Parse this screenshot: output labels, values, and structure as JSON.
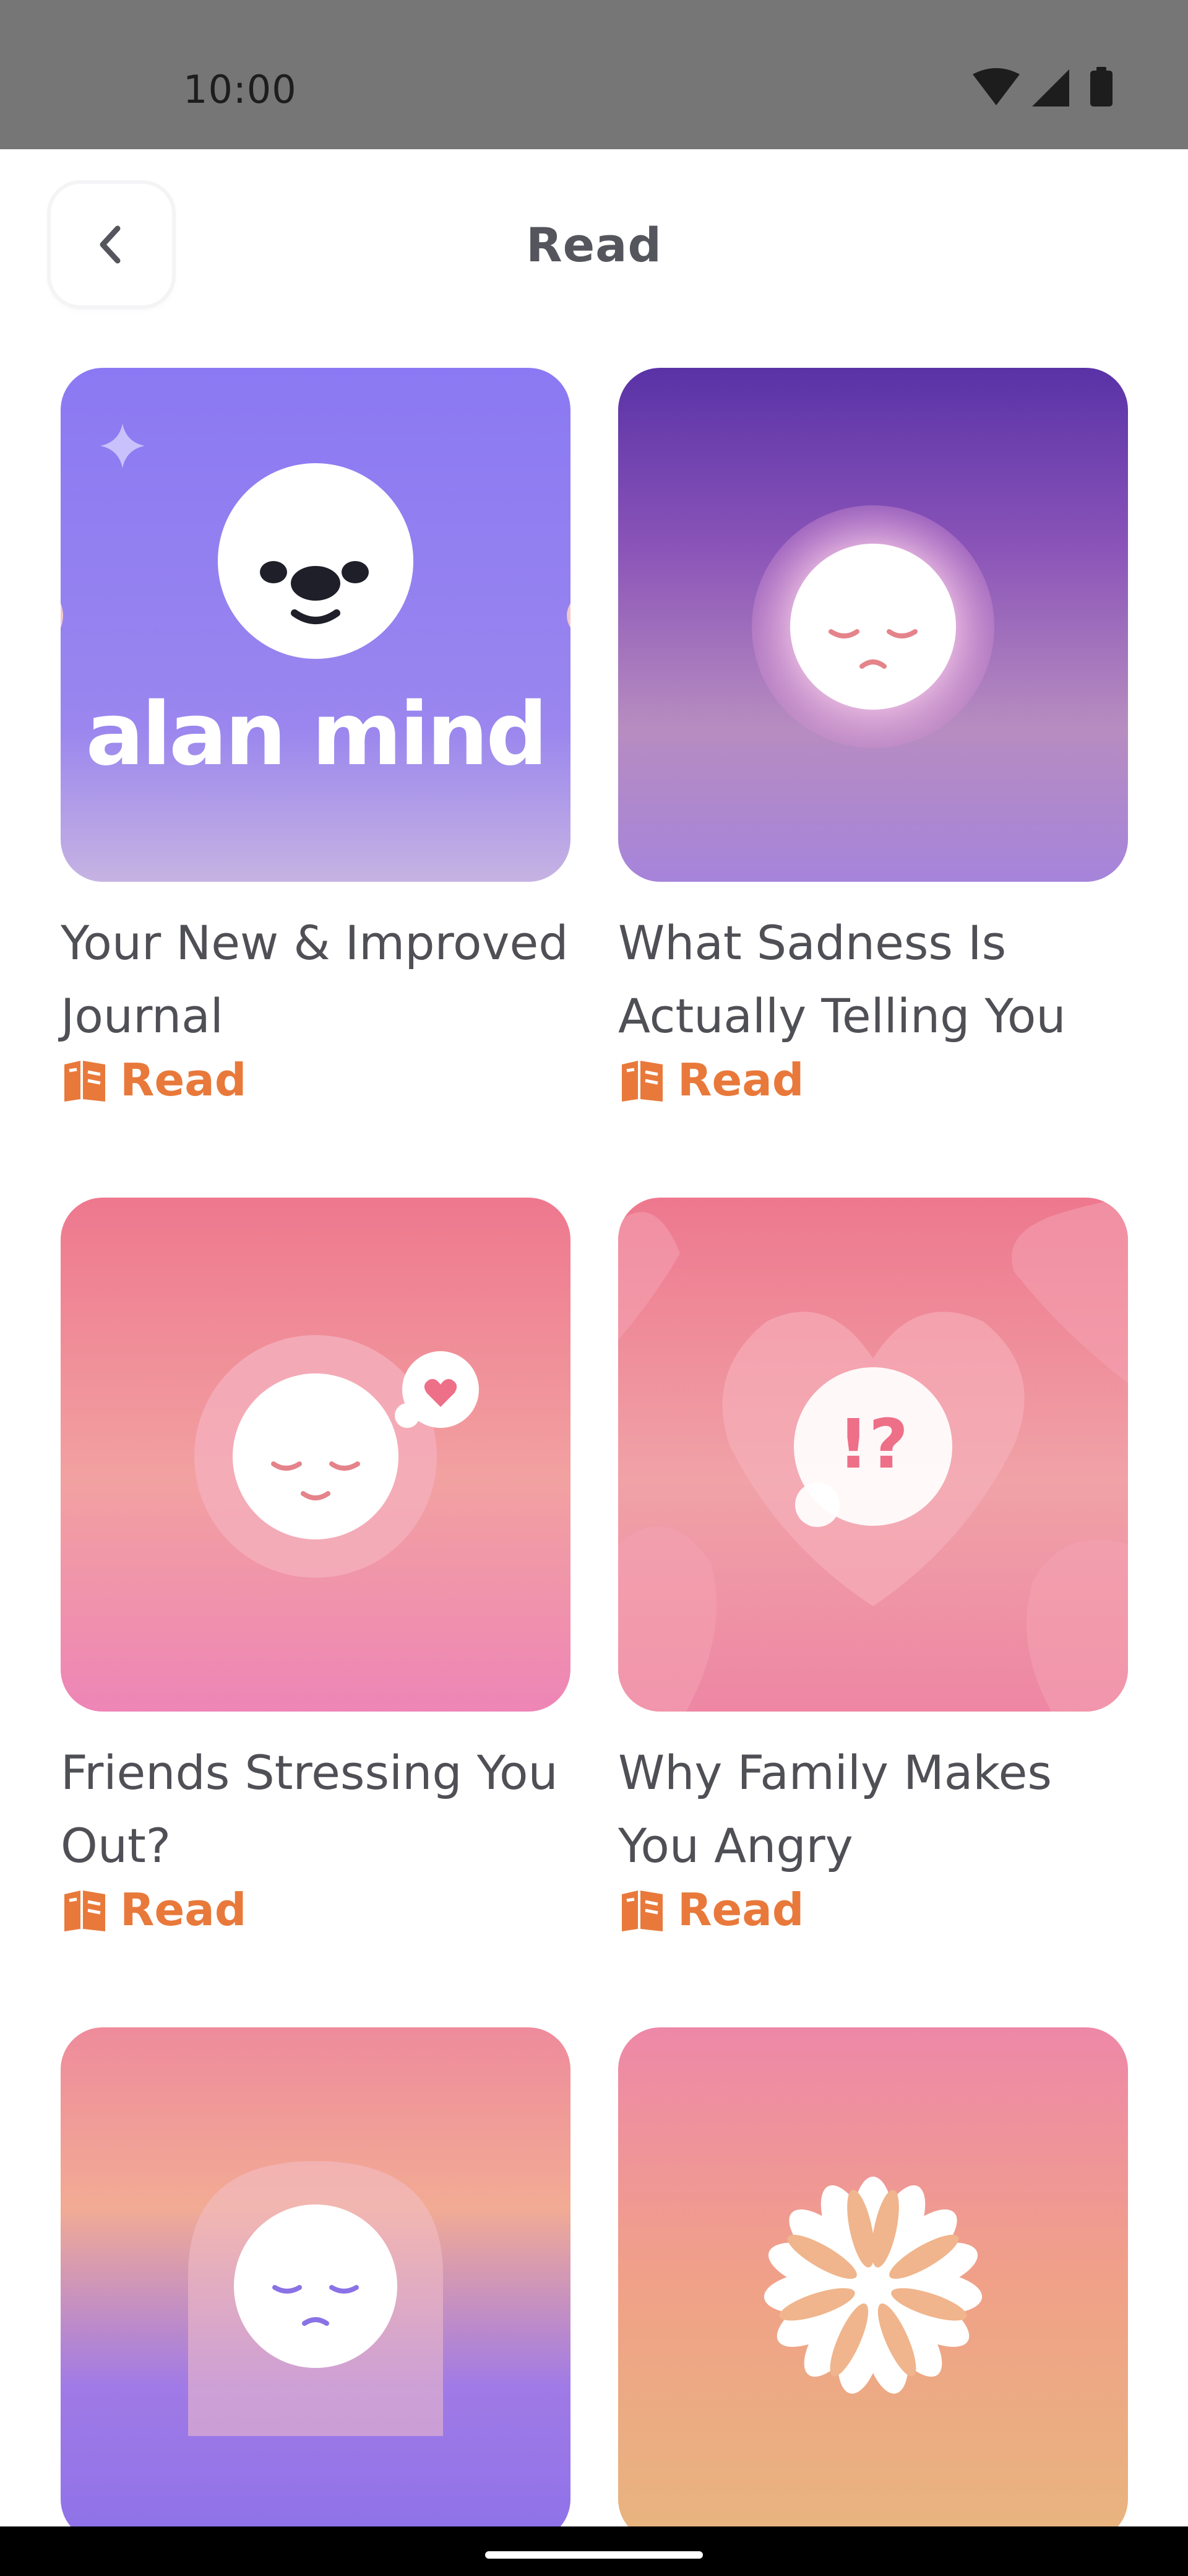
{
  "status_bar": {
    "time": "10:00",
    "icons": [
      "wifi-icon",
      "signal-icon",
      "battery-icon"
    ]
  },
  "header": {
    "title": "Read",
    "back_icon": "chevron-left-icon"
  },
  "cards": [
    {
      "title": "Your New & Improved Journal",
      "action_label": "Read",
      "logo_text": "alan mind",
      "icon": "book-icon"
    },
    {
      "title": "What Sadness Is Actually Telling You",
      "action_label": "Read",
      "icon": "book-icon"
    },
    {
      "title": "Friends Stressing You Out?",
      "action_label": "Read",
      "icon": "book-icon"
    },
    {
      "title": "Why Family Makes You Angry",
      "action_label": "Read",
      "icon": "book-icon",
      "bubble_text": "!?"
    },
    {
      "title": "",
      "action_label": "",
      "icon": ""
    },
    {
      "title": "",
      "action_label": "",
      "icon": ""
    }
  ],
  "colors": {
    "accent": "#e8793b",
    "title_text": "#4f4f56",
    "status_bar": "#767676"
  }
}
